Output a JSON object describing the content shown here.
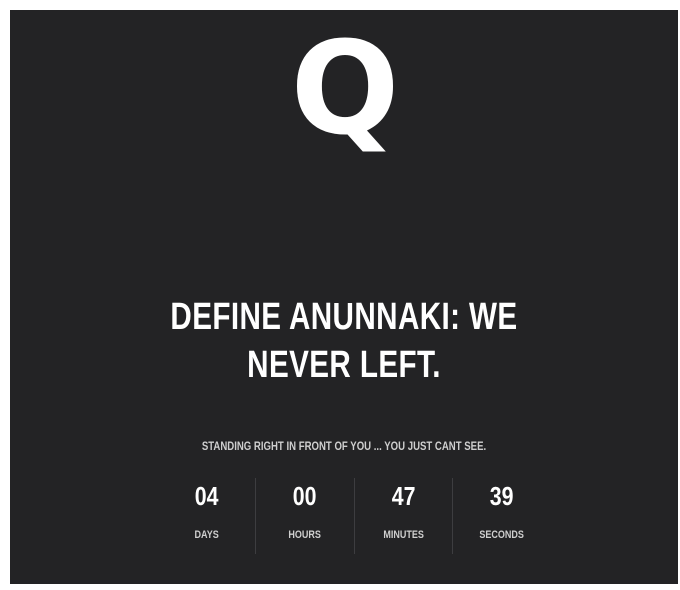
{
  "logo": {
    "letter": "Q"
  },
  "headline": {
    "line1": "DEFINE ANUNNAKI: WE",
    "line2": "NEVER LEFT."
  },
  "tagline": "STANDING RIGHT IN FRONT OF YOU ... YOU JUST CANT SEE.",
  "countdown": {
    "days": {
      "value": "04",
      "label": "DAYS"
    },
    "hours": {
      "value": "00",
      "label": "HOURS"
    },
    "minutes": {
      "value": "47",
      "label": "MINUTES"
    },
    "seconds": {
      "value": "39",
      "label": "SECONDS"
    }
  },
  "colors": {
    "background": "#232325",
    "text": "#ffffff",
    "muted_text": "#cfcfcf"
  }
}
